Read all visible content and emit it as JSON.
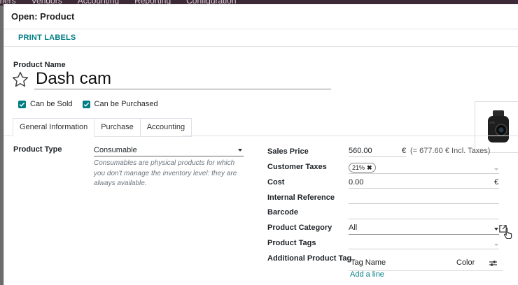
{
  "topbar": {
    "menus": [
      "mers",
      "Vendors",
      "Accounting",
      "Reporting",
      "Configuration"
    ]
  },
  "modal": {
    "title": "Open: Product"
  },
  "control_bar": {
    "print_labels": "PRINT LABELS"
  },
  "product": {
    "name_label": "Product Name",
    "name": "Dash cam",
    "can_be_sold": "Can be Sold",
    "can_be_purchased": "Can be Purchased",
    "image_icon": "dash-cam-image"
  },
  "tabs": [
    {
      "label": "General Information",
      "active": true
    },
    {
      "label": "Purchase",
      "active": false
    },
    {
      "label": "Accounting",
      "active": false
    }
  ],
  "general": {
    "product_type_label": "Product Type",
    "product_type_value": "Consumable",
    "product_type_help": "Consumables are physical products for which you don't manage the inventory level: they are always available.",
    "sales_price_label": "Sales Price",
    "sales_price_value": "560.00",
    "sales_price_currency": "€",
    "sales_price_incl": "(= 677.60 € Incl. Taxes)",
    "customer_taxes_label": "Customer Taxes",
    "customer_taxes_tag": "21%",
    "cost_label": "Cost",
    "cost_value": "0.00",
    "cost_currency": "€",
    "internal_reference_label": "Internal Reference",
    "barcode_label": "Barcode",
    "product_category_label": "Product Category",
    "product_category_value": "All",
    "product_tags_label": "Product Tags",
    "additional_tag_label": "Additional Product Tag",
    "tag_table": {
      "col_name": "Tag Name",
      "col_color": "Color",
      "add_line": "Add a line"
    }
  },
  "colors": {
    "accent": "#017e84",
    "topbar": "#3e2a37"
  }
}
